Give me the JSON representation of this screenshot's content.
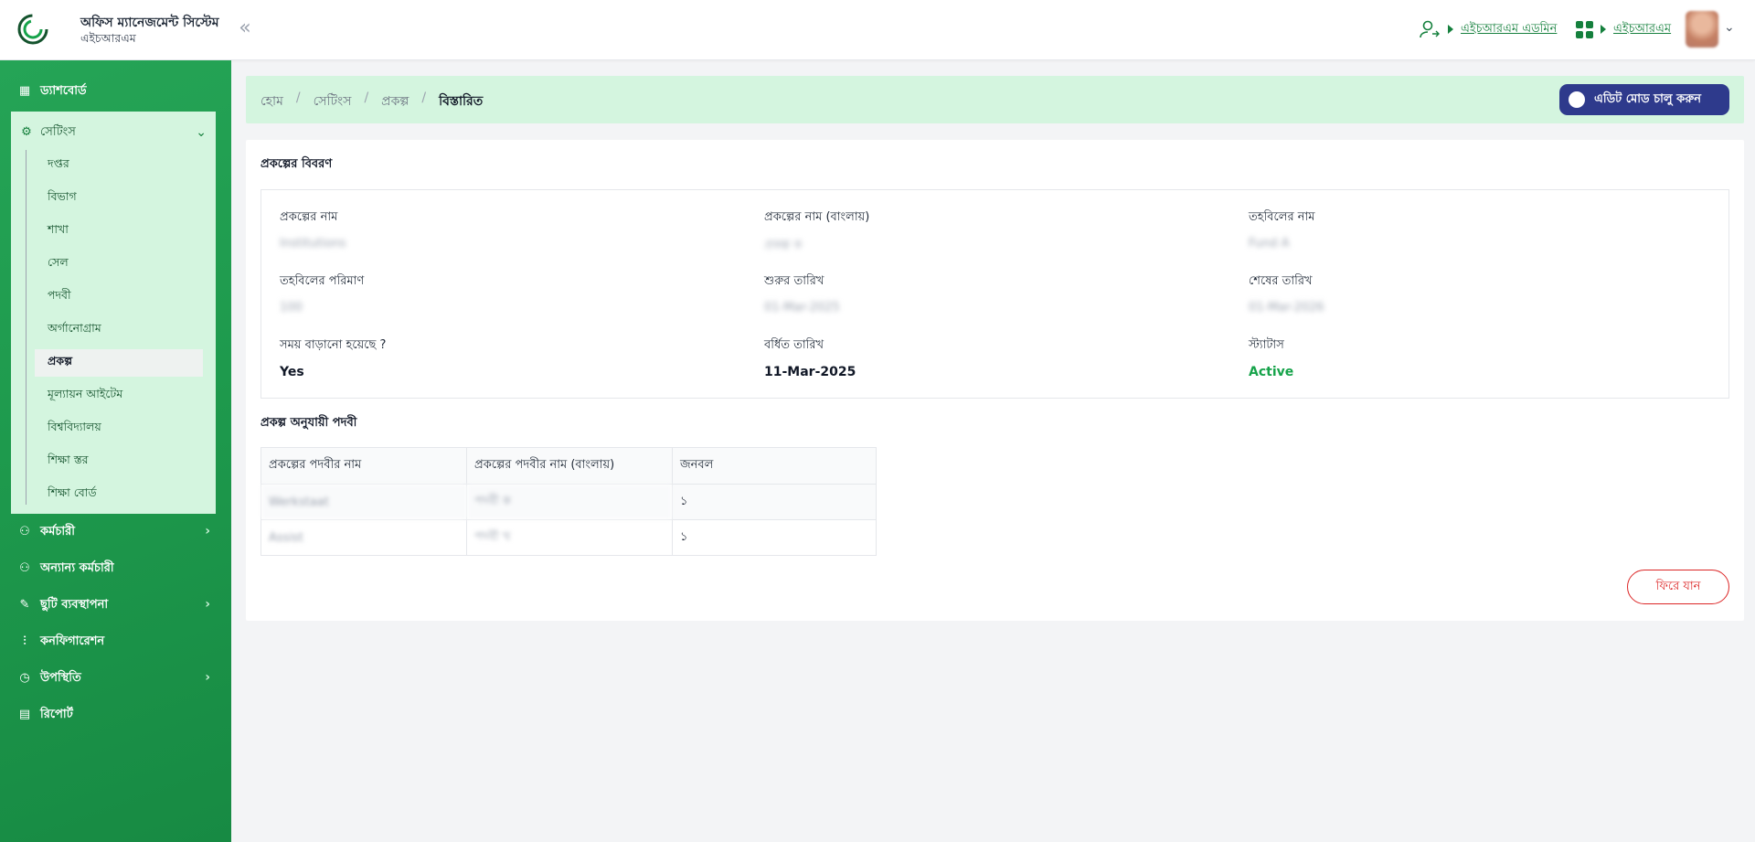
{
  "header": {
    "app_title": "অফিস ম্যানেজমেন্ট সিস্টেম",
    "app_subtitle": "এইচআরএম",
    "user_role": "এইচআরএম এডমিন",
    "app_switch": "এইচআরএম"
  },
  "sidebar": {
    "dashboard": "ড্যাশবোর্ড",
    "settings": "সেটিংস",
    "settings_items": [
      "দপ্তর",
      "বিভাগ",
      "শাখা",
      "সেল",
      "পদবী",
      "অর্গানোগ্রাম",
      "প্রকল্প",
      "মূল্যায়ন আইটেম",
      "বিশ্ববিদ্যালয়",
      "শিক্ষা স্তর",
      "শিক্ষা বোর্ড"
    ],
    "active_item": "প্রকল্প",
    "employee": "কর্মচারী",
    "other_employee": "অন্যান্য কর্মচারী",
    "leave_management": "ছুটি ব্যবস্থাপনা",
    "configuration": "কনফিগারেশন",
    "attendance": "উপস্থিতি",
    "report": "রিপোর্ট"
  },
  "breadcrumb": {
    "home": "হোম",
    "settings": "সেটিংস",
    "project": "প্রকল্প",
    "current": "বিস্তারিত"
  },
  "edit_mode_label": "এডিট মোড চালু করুন",
  "details": {
    "section_title": "প্রকল্পের বিবরণ",
    "project_name_label": "প্রকল্পের নাম",
    "project_name_value": "Institutions",
    "project_name_bn_label": "প্রকল্পের নাম (বাংলায়)",
    "project_name_bn_value": "প্রকল্প ক",
    "fund_name_label": "তহবিলের নাম",
    "fund_name_value": "Fund A",
    "fund_amount_label": "তহবিলের পরিমাণ",
    "fund_amount_value": "100",
    "start_date_label": "শুরুর তারিখ",
    "start_date_value": "01-Mar-2025",
    "end_date_label": "শেষের তারিখ",
    "end_date_value": "01-Mar-2026",
    "extended_label": "সময় বাড়ানো হয়েছে ?",
    "extended_value": "Yes",
    "extended_date_label": "বর্ধিত তারিখ",
    "extended_date_value": "11-Mar-2025",
    "status_label": "স্ট্যাটাস",
    "status_value": "Active"
  },
  "designation_table": {
    "section_title": "প্রকল্প অনুযায়ী পদবী",
    "headers": [
      "প্রকল্পের পদবীর নাম",
      "প্রকল্পের পদবীর নাম (বাংলায়)",
      "জনবল"
    ],
    "rows": [
      [
        "Werkstaat",
        "পদবী ক",
        "১"
      ],
      [
        "Assist",
        "পদবী খ",
        "১"
      ]
    ]
  },
  "back_label": "ফিরে যান",
  "colors": {
    "brand_green": "#1e9a4d",
    "light_green": "#d4f5df",
    "navy": "#2e3a8c",
    "danger": "#dc2626"
  }
}
